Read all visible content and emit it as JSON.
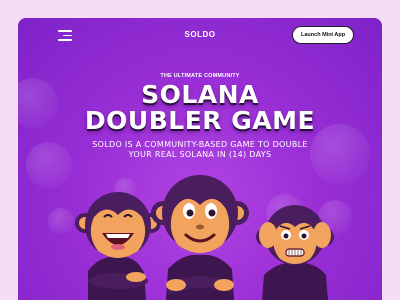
{
  "nav": {
    "menu_icon": "menu-icon",
    "brand": "SOLDO",
    "launch_button": "Launch Mini App"
  },
  "hero": {
    "eyebrow": "THE ULTIMATE COMMUNITY",
    "title_line1": "SOLANA",
    "title_line2": "DOUBLER GAME",
    "subtitle_line1": "SOLDO IS A COMMUNITY-BASED GAME TO DOUBLE",
    "subtitle_line2": "YOUR REAL SOLANA IN (14) DAYS"
  },
  "mascots": {
    "items": [
      "laughing-monkey",
      "smiling-monkey",
      "worried-monkey"
    ]
  },
  "colors": {
    "page_background": "#f7dcf5",
    "hero_purple": "#9a2fd6",
    "hero_purple_dark": "#7e22c8",
    "monkey_fur": "#4a1d5e",
    "monkey_face": "#f2a35e",
    "button_bg": "#ffffff"
  }
}
